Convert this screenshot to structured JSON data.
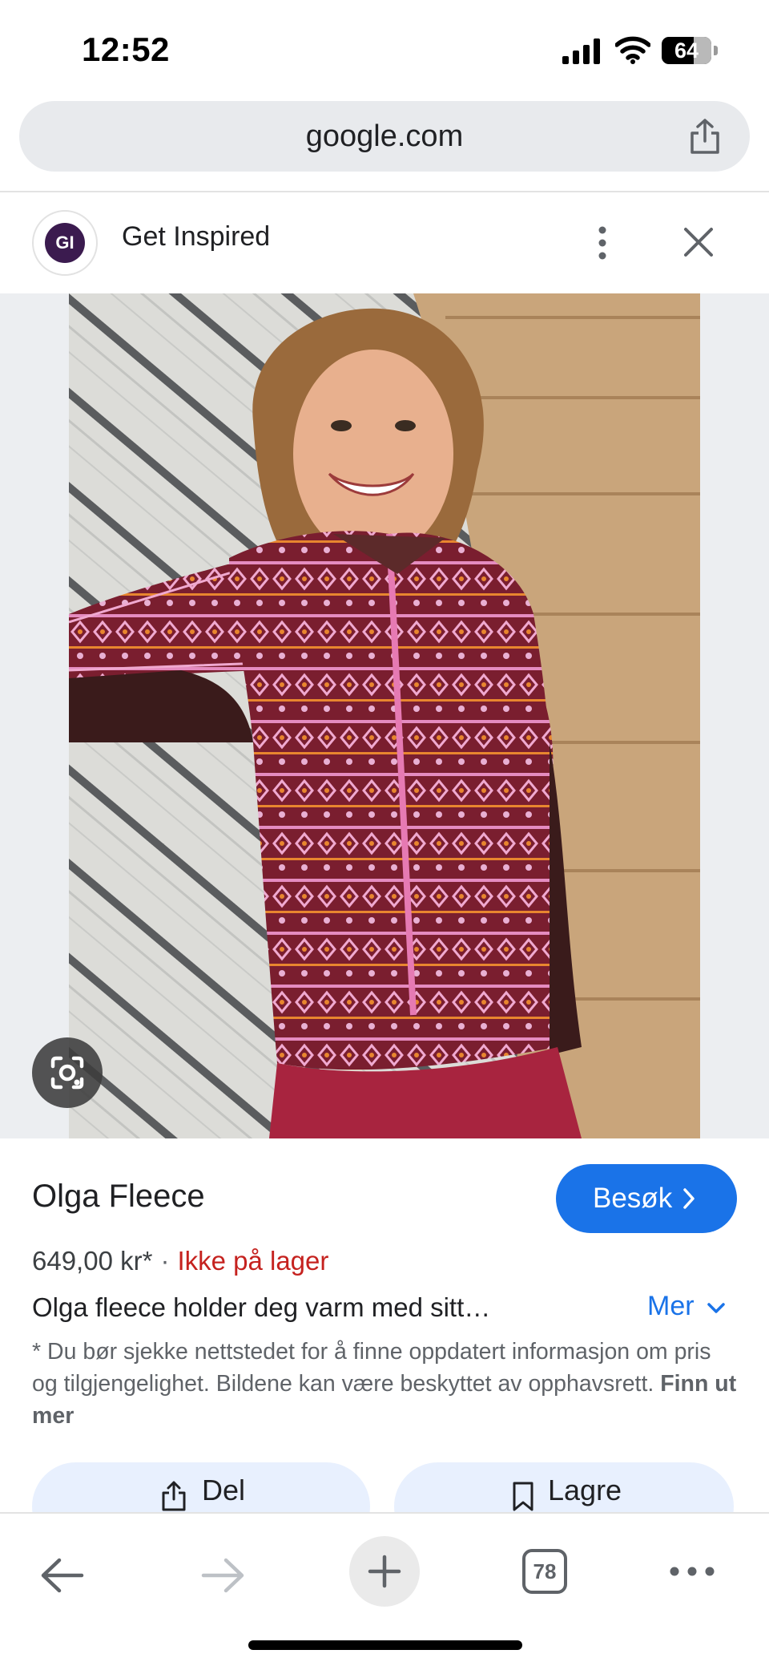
{
  "status_bar": {
    "time": "12:52",
    "battery": "64",
    "battery_level": 0.64
  },
  "browser": {
    "url": "google.com"
  },
  "source": {
    "avatar_text": "GI",
    "name": "Get Inspired"
  },
  "product": {
    "title": "Olga Fleece",
    "visit_label": "Besøk",
    "price": "649,00 kr*",
    "separator": "·",
    "stock": "Ikke på lager",
    "description": "Olga fleece holder deg varm med sitt…",
    "more_label": "Mer",
    "disclaimer": "* Du bør sjekke nettstedet for å finne oppdatert informasjon om pris og tilgjengelighet. Bildene kan være beskyttet av opphavsrett.",
    "learn_more": "Finn ut mer"
  },
  "actions": {
    "share_label": "Del",
    "save_label": "Lagre"
  },
  "toolbar": {
    "tab_count": "78"
  },
  "colors": {
    "accent": "#1a73e8",
    "stock_red": "#c5221f",
    "sweater": "#7a1e2f",
    "pants": "#a8243f",
    "pill_bg": "#e8f0fe"
  }
}
